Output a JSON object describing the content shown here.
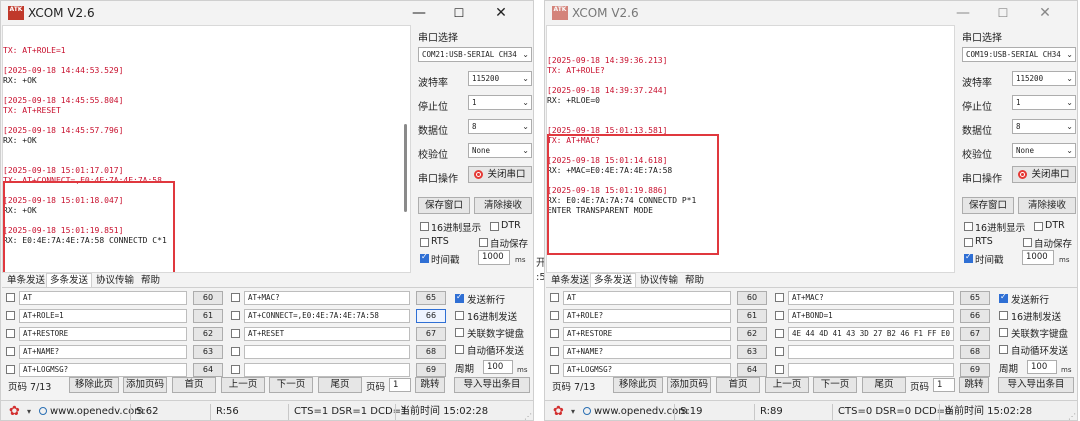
{
  "left": {
    "title": "XCOM V2.6",
    "icon_text": "ATK",
    "recv_lines": [
      {
        "cls": "tx",
        "text": "TX: AT+ROLE=1"
      },
      {
        "cls": "rx",
        "text": ""
      },
      {
        "cls": "ts",
        "text": "[2025-09-18 14:44:53.529]"
      },
      {
        "cls": "rx",
        "text": "RX: +OK"
      },
      {
        "cls": "rx",
        "text": ""
      },
      {
        "cls": "ts",
        "text": "[2025-09-18 14:45:55.804]"
      },
      {
        "cls": "tx",
        "text": "TX: AT+RESET"
      },
      {
        "cls": "rx",
        "text": ""
      },
      {
        "cls": "ts",
        "text": "[2025-09-18 14:45:57.796]"
      },
      {
        "cls": "rx",
        "text": "RX: +OK"
      },
      {
        "cls": "rx",
        "text": ""
      },
      {
        "cls": "rx",
        "text": ""
      },
      {
        "cls": "ts",
        "text": "[2025-09-18 15:01:17.017]"
      },
      {
        "cls": "tx",
        "text": "TX: AT+CONNECT=,E0:4E:7A:4E:7A:58"
      },
      {
        "cls": "rx",
        "text": ""
      },
      {
        "cls": "ts",
        "text": "[2025-09-18 15:01:18.047]"
      },
      {
        "cls": "rx",
        "text": "RX: +OK"
      },
      {
        "cls": "rx",
        "text": ""
      },
      {
        "cls": "ts",
        "text": "[2025-09-18 15:01:19.851]"
      },
      {
        "cls": "rx",
        "text": "RX: E0:4E:7A:4E:7A:58 CONNECTD C*1"
      }
    ],
    "panel": {
      "port_label": "串口选择",
      "port_value": "COM21:USB-SERIAL CH34",
      "baud_label": "波特率",
      "baud_value": "115200",
      "stop_label": "停止位",
      "stop_value": "1",
      "data_label": "数据位",
      "data_value": "8",
      "parity_label": "校验位",
      "parity_value": "None",
      "op_label": "串口操作",
      "op_button": "关闭串口",
      "save_button": "保存窗口",
      "clear_button": "清除接收",
      "hex_label": "16进制显示",
      "dtr_label": "DTR",
      "rts_label": "RTS",
      "autosave_label": "自动保存",
      "timestamp_label": "时间戳",
      "timestamp_value": "1000",
      "timestamp_unit": "ms"
    },
    "tabs": [
      "单条发送",
      "多条发送",
      "协议传输",
      "帮助"
    ],
    "rows_left": [
      {
        "text": "AT",
        "num": "60"
      },
      {
        "text": "AT+ROLE=1",
        "num": "61"
      },
      {
        "text": "AT+RESTORE",
        "num": "62"
      },
      {
        "text": "AT+NAME?",
        "num": "63"
      },
      {
        "text": "AT+LOGMSG?",
        "num": "64"
      }
    ],
    "rows_right": [
      {
        "text": "AT+MAC?",
        "num": "65"
      },
      {
        "text": "AT+CONNECT=,E0:4E:7A:4E:7A:58",
        "num": "66"
      },
      {
        "text": "AT+RESET",
        "num": "67"
      },
      {
        "text": "",
        "num": "68"
      },
      {
        "text": "",
        "num": "69"
      }
    ],
    "opts": {
      "newline": "发送新行",
      "hexsend": "16进制发送",
      "numpad": "关联数字键盘",
      "loop": "自动循环发送",
      "period_label": "周期",
      "period_value": "100",
      "period_unit": "ms"
    },
    "pager": {
      "page": "页码 7/13",
      "remove": "移除此页",
      "add": "添加页码",
      "first": "首页",
      "prev": "上一页",
      "next": "下一页",
      "last": "尾页",
      "goto_label": "页码",
      "goto_value": "1",
      "jump": "跳转",
      "import": "导入导出条目"
    },
    "status": {
      "url": "www.openedv.com",
      "s": "S:62",
      "r": "R:56",
      "lines": "CTS=1 DSR=1 DCD=1",
      "time": "当前时间 15:02:28"
    }
  },
  "right": {
    "title": "XCOM V2.6",
    "icon_text": "ATK",
    "recv_lines": [
      {
        "cls": "rx",
        "text": ""
      },
      {
        "cls": "ts",
        "text": "[2025-09-18 14:39:36.213]"
      },
      {
        "cls": "tx",
        "text": "TX: AT+ROLE?"
      },
      {
        "cls": "rx",
        "text": ""
      },
      {
        "cls": "ts",
        "text": "[2025-09-18 14:39:37.244]"
      },
      {
        "cls": "rx",
        "text": "RX: +RLOE=0"
      },
      {
        "cls": "rx",
        "text": ""
      },
      {
        "cls": "rx",
        "text": ""
      },
      {
        "cls": "ts",
        "text": "[2025-09-18 15:01:13.581]"
      },
      {
        "cls": "tx",
        "text": "TX: AT+MAC?"
      },
      {
        "cls": "rx",
        "text": ""
      },
      {
        "cls": "ts",
        "text": "[2025-09-18 15:01:14.618]"
      },
      {
        "cls": "rx",
        "text": "RX: +MAC=E0:4E:7A:4E:7A:58"
      },
      {
        "cls": "rx",
        "text": ""
      },
      {
        "cls": "ts",
        "text": "[2025-09-18 15:01:19.886]"
      },
      {
        "cls": "rx",
        "text": "RX: E0:4E:7A:7A:74 CONNECTD P*1"
      },
      {
        "cls": "rx",
        "text": "ENTER TRANSPARENT MODE"
      }
    ],
    "panel": {
      "port_label": "串口选择",
      "port_value": "COM19:USB-SERIAL CH34",
      "baud_label": "波特率",
      "baud_value": "115200",
      "stop_label": "停止位",
      "stop_value": "1",
      "data_label": "数据位",
      "data_value": "8",
      "parity_label": "校验位",
      "parity_value": "None",
      "op_label": "串口操作",
      "op_button": "关闭串口",
      "save_button": "保存窗口",
      "clear_button": "清除接收",
      "hex_label": "16进制显示",
      "dtr_label": "DTR",
      "rts_label": "RTS",
      "autosave_label": "自动保存",
      "timestamp_label": "时间戳",
      "timestamp_value": "1000",
      "timestamp_unit": "ms"
    },
    "tabs": [
      "单条发送",
      "多条发送",
      "协议传输",
      "帮助"
    ],
    "rows_left": [
      {
        "text": "AT",
        "num": "60"
      },
      {
        "text": "AT+ROLE?",
        "num": "61"
      },
      {
        "text": "AT+RESTORE",
        "num": "62"
      },
      {
        "text": "AT+NAME?",
        "num": "63"
      },
      {
        "text": "AT+LOGMSG?",
        "num": "64"
      }
    ],
    "rows_right": [
      {
        "text": "AT+MAC?",
        "num": "65"
      },
      {
        "text": "AT+BOND=1",
        "num": "66"
      },
      {
        "text": "4E 44 4D 41 43 3D 27 B2 46 F1 FF E0",
        "num": "67"
      },
      {
        "text": "",
        "num": "68"
      },
      {
        "text": "",
        "num": "69"
      }
    ],
    "opts": {
      "newline": "发送新行",
      "hexsend": "16进制发送",
      "numpad": "关联数字键盘",
      "loop": "自动循环发送",
      "period_label": "周期",
      "period_value": "100",
      "period_unit": "ms"
    },
    "pager": {
      "page": "页码 7/13",
      "remove": "移除此页",
      "add": "添加页码",
      "first": "首页",
      "prev": "上一页",
      "next": "下一页",
      "last": "尾页",
      "goto_label": "页码",
      "goto_value": "1",
      "jump": "跳转",
      "import": "导入导出条目"
    },
    "status": {
      "url": "www.openedv.com",
      "s": "S:19",
      "r": "R:89",
      "lines": "CTS=0 DSR=0 DCD=0",
      "time": "当前时间 15:02:28"
    }
  },
  "between": {
    "colon": ":5",
    "char": "开"
  },
  "window_controls": {
    "min": "—",
    "max": "☐",
    "close": "✕"
  },
  "colors": {
    "tx": "#c8102e",
    "highlight": "#e0383e",
    "accent": "#2f6fd4"
  }
}
